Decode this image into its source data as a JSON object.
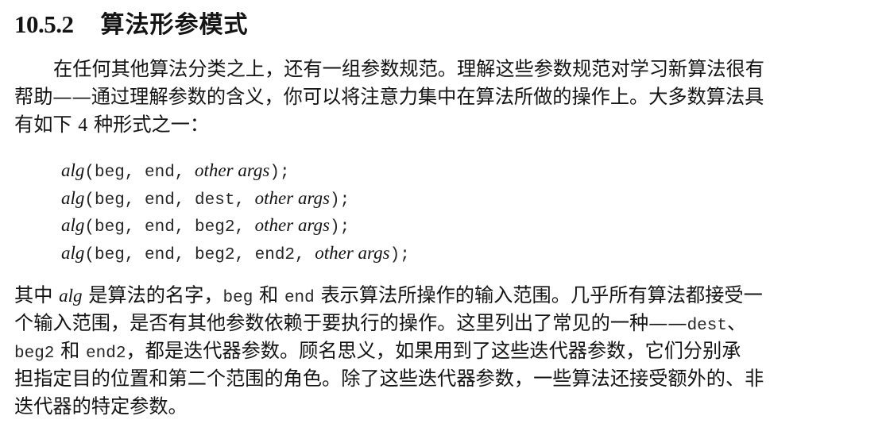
{
  "section": {
    "number": "10.5.2",
    "title": "算法形参模式"
  },
  "paragraph1": {
    "line1": "在任何其他算法分类之上，还有一组参数规范。理解这些参数规范对学习新算法很有",
    "line2": "帮助——通过理解参数的含义，你可以将注意力集中在算法所做的操作上。大多数算法具",
    "line3_pre": "有如下",
    "line3_num": "4",
    "line3_post": "种形式之一："
  },
  "code": {
    "line1": {
      "fn": "alg",
      "open": "(beg, end, ",
      "args": "other args",
      "close": ");"
    },
    "line2": {
      "fn": "alg",
      "open": "(beg, end, dest, ",
      "args": "other args",
      "close": ");"
    },
    "line3": {
      "fn": "alg",
      "open": "(beg, end, beg2, ",
      "args": "other args",
      "close": ");"
    },
    "line4": {
      "fn": "alg",
      "open": "(beg, end, beg2, end2, ",
      "args": "other args",
      "close": ");"
    }
  },
  "paragraph2": {
    "l1_a": "其中",
    "l1_alg": "alg",
    "l1_b": "是算法的名字，",
    "l1_beg": "beg",
    "l1_c": "和",
    "l1_end": "end",
    "l1_d": "表示算法所操作的输入范围。几乎所有算法都接受一",
    "l2_a": "个输入范围，是否有其他参数依赖于要执行的操作。这里列出了常见的一种——",
    "l2_dest": "dest",
    "l2_b": "、",
    "l3_beg2": "beg2",
    "l3_a": "和",
    "l3_end2": "end2",
    "l3_b": "，都是迭代器参数。顾名思义，如果用到了这些迭代器参数，它们分别承",
    "l4": "担指定目的位置和第二个范围的角色。除了这些迭代器参数，一些算法还接受额外的、非",
    "l5": "迭代器的特定参数。"
  }
}
